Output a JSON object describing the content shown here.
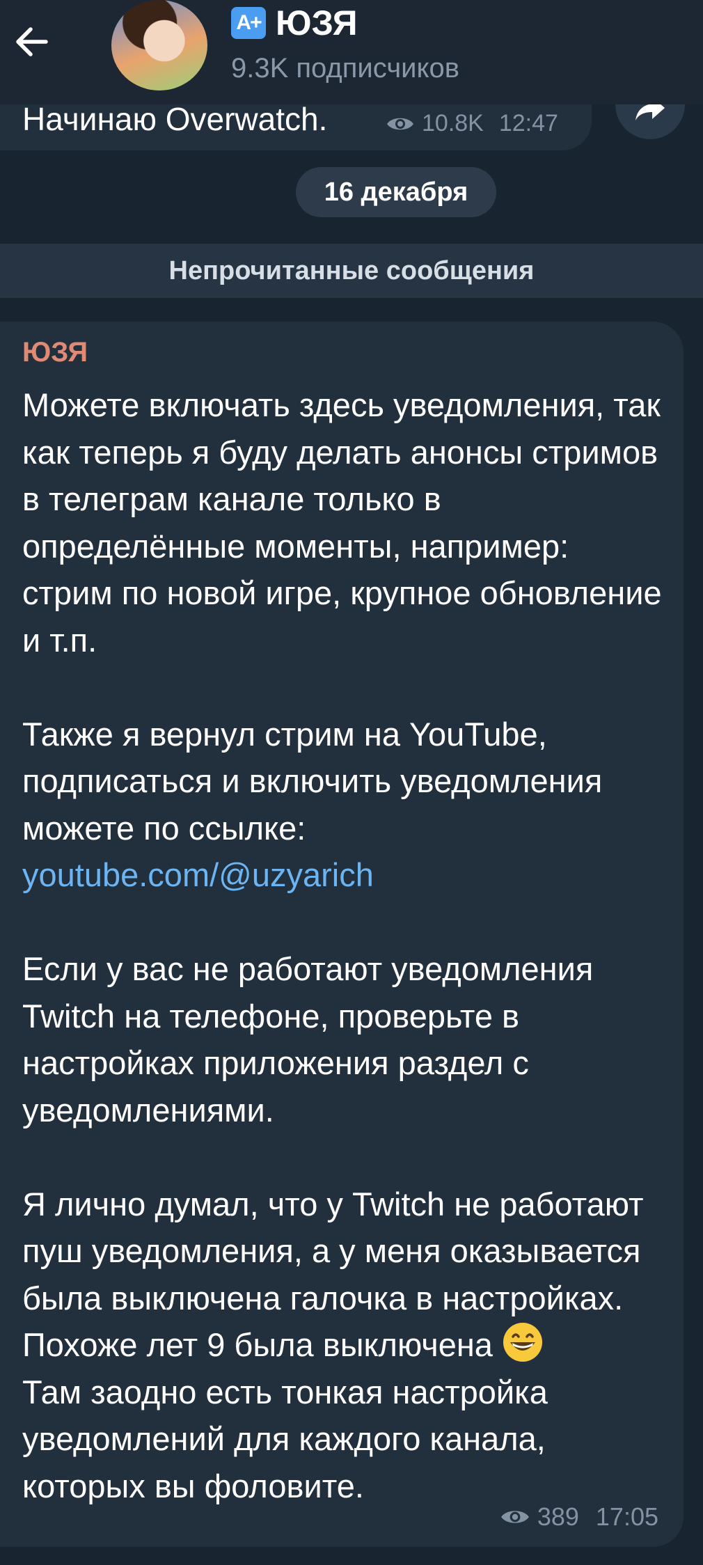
{
  "header": {
    "back_label": "back",
    "badge_text": "A+",
    "title": "ЮЗЯ",
    "subscribers": "9.3K подписчиков"
  },
  "previous_message": {
    "text": "Начинаю Overwatch.",
    "views": "10.8K",
    "time": "12:47"
  },
  "date_chip": "16 декабря",
  "unread_divider": "Непрочитанные сообщения",
  "message": {
    "author": "ЮЗЯ",
    "p1": "Можете включать здесь уведомления, так как теперь я буду делать анонсы стримов в телеграм канале только в определённые моменты, например: стрим по новой игре, крупное обновление и т.п.",
    "p2_text": "Также я вернул стрим на YouTube, подписаться и включить уведомления можете по ссылке:",
    "p2_link": "youtube.com/@uzyarich",
    "p3": "Если у вас не работают уведомления Twitch на телефоне, проверьте в настройках приложения раздел с уведомлениями.",
    "p4": "Я лично думал, что у Twitch не работают пуш уведомления, а у меня оказывается была выключена галочка в настройках. Похоже лет 9 была выключена",
    "p5": "Там заодно есть тонкая настройка уведомлений для каждого канала, которых вы фоловите.",
    "views": "389",
    "time": "17:05"
  },
  "colors": {
    "background": "#182430",
    "bubble": "#222f3d",
    "author": "#e08a73",
    "link": "#6cb5f2",
    "meta": "#8393a4"
  },
  "icons": {
    "back": "arrow-left-icon",
    "views": "eye-icon",
    "share": "share-arrow-icon",
    "emoji": "grinning-face-emoji"
  }
}
